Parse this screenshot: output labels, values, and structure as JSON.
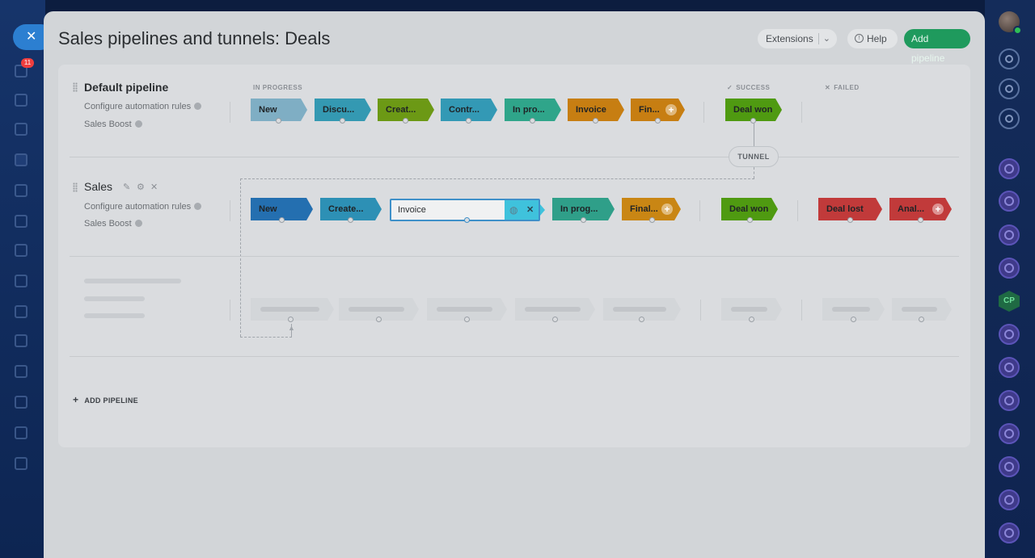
{
  "app": {
    "title": "Sales pipelines and tunnels: Deals",
    "left_badge": "11"
  },
  "header": {
    "extensions_label": "Extensions",
    "help_label": "Help",
    "add_pipeline_label": "Add pipeline"
  },
  "columns": {
    "in_progress": "IN PROGRESS",
    "success": "SUCCESS",
    "failed": "FAILED"
  },
  "pipelines": [
    {
      "name": "Default pipeline",
      "automation_label": "Configure automation rules",
      "boost_label": "Sales Boost",
      "stages": [
        {
          "label": "New",
          "color": "#7faec4"
        },
        {
          "label": "Discu...",
          "color": "#3499b2"
        },
        {
          "label": "Creat...",
          "color": "#6c9915"
        },
        {
          "label": "Contr...",
          "color": "#3399b5"
        },
        {
          "label": "In pro...",
          "color": "#2fa58a"
        },
        {
          "label": "Invoice",
          "color": "#c77e12"
        },
        {
          "label": "Fin...",
          "color": "#c77e12"
        }
      ],
      "success": [
        {
          "label": "Deal won",
          "color": "#4f9a11"
        }
      ],
      "failed": []
    },
    {
      "name": "Sales",
      "automation_label": "Configure automation rules",
      "boost_label": "Sales Boost",
      "stages": [
        {
          "label": "New",
          "color": "#246fb0"
        },
        {
          "label": "Create...",
          "color": "#2d90b5"
        },
        {
          "label": "Invoice",
          "color": "#f0f1f2"
        },
        {
          "label": "In prog...",
          "color": "#2f9f89"
        },
        {
          "label": "Final...",
          "color": "#c98614"
        }
      ],
      "success": [
        {
          "label": "Deal won",
          "color": "#4f9a11"
        }
      ],
      "failed": [
        {
          "label": "Deal lost",
          "color": "#c13a3a"
        },
        {
          "label": "Anal...",
          "color": "#c13a3a"
        }
      ]
    }
  ],
  "tunnel_label": "TUNNEL",
  "add_pipeline_link": "ADD PIPELINE"
}
